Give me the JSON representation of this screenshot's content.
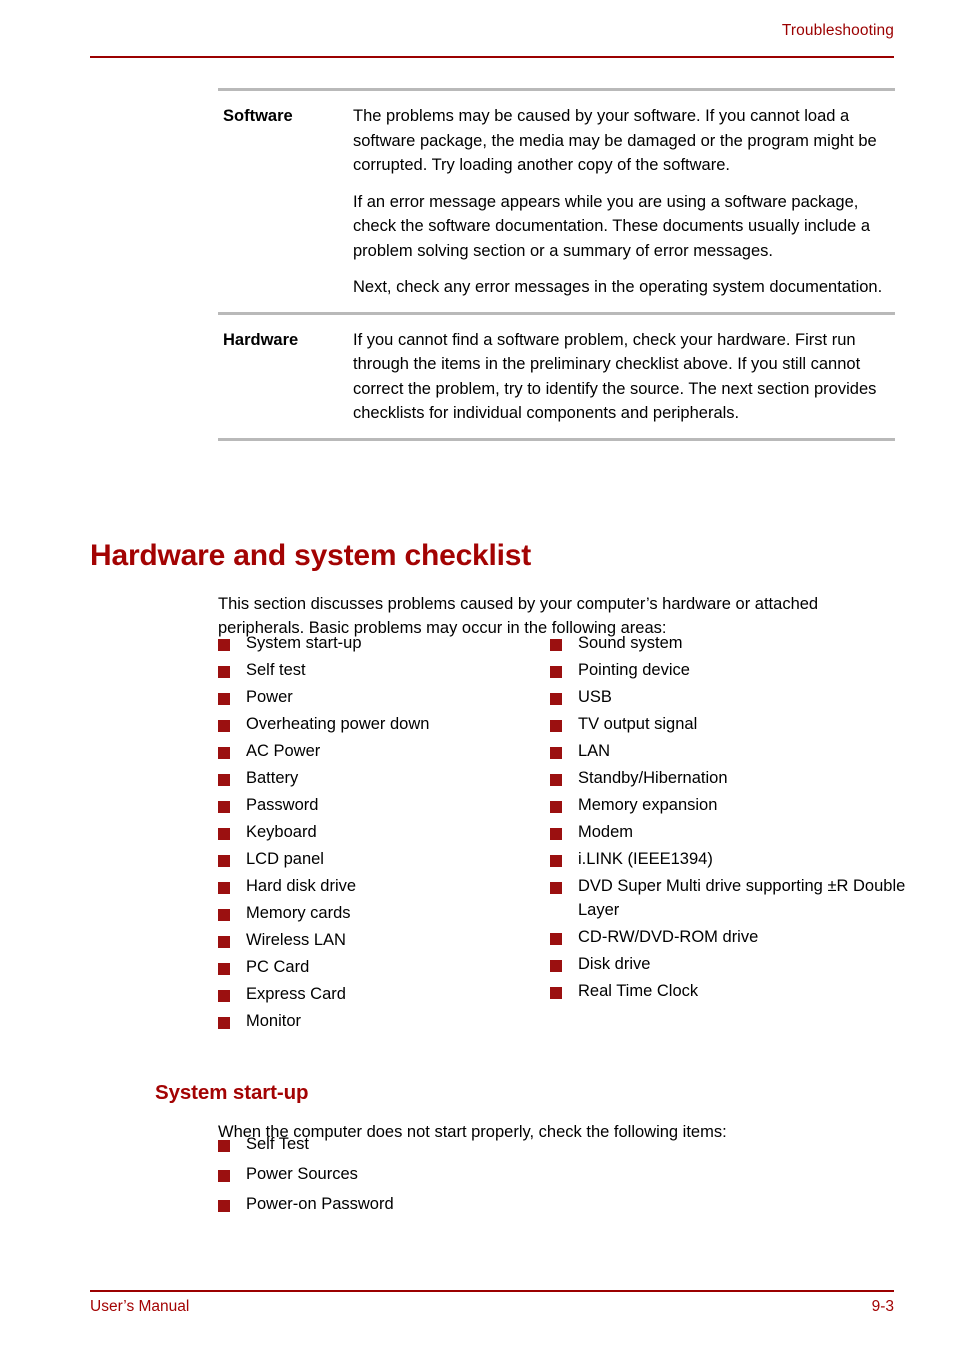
{
  "header": {
    "title": "Troubleshooting"
  },
  "definition_table": {
    "rows": [
      {
        "term": "Software",
        "paragraphs": [
          "The problems may be caused by your software. If you cannot load a software package, the media may be damaged or the program might be corrupted. Try loading another copy of the software.",
          "If an error message appears while you are using a software package, check the software documentation. These documents usually include a problem solving section or a summary of error messages.",
          "Next, check any error messages in the operating system documentation."
        ]
      },
      {
        "term": "Hardware",
        "paragraphs": [
          "If you cannot find a software problem, check your hardware. First run through the items in the preliminary checklist above. If you still cannot correct the problem, try to identify the source. The next section provides checklists for individual components and peripherals."
        ]
      }
    ]
  },
  "section": {
    "heading": "Hardware and system checklist",
    "intro": "This section discusses problems caused by your computer’s hardware or attached peripherals. Basic problems may occur in the following areas:",
    "checklist_left": [
      "System start-up",
      "Self test",
      "Power",
      "Overheating power down",
      "AC Power",
      "Battery",
      "Password",
      "Keyboard",
      "LCD panel",
      "Hard disk drive",
      "Memory cards",
      "Wireless LAN",
      "PC Card",
      "Express Card",
      "Monitor"
    ],
    "checklist_right": [
      "Sound system",
      "Pointing device",
      "USB",
      "TV output signal",
      "LAN",
      "Standby/Hibernation",
      "Memory expansion",
      "Modem",
      "i.LINK (IEEE1394)",
      "DVD Super Multi drive supporting ±R Double Layer",
      "CD-RW/DVD-ROM drive",
      "Disk drive",
      "Real Time Clock"
    ]
  },
  "subsection": {
    "heading": "System start-up",
    "intro": "When the computer does not start properly, check the following items:",
    "items": [
      "Self Test",
      "Power Sources",
      "Power-on Password"
    ]
  },
  "footer": {
    "left": "User’s Manual",
    "right": "9-3"
  },
  "colors": {
    "accent_red": "#9B0000",
    "heading_red": "#A30303",
    "bullet_red": "#9B1010",
    "rule_gray": "#b9b9b9"
  }
}
